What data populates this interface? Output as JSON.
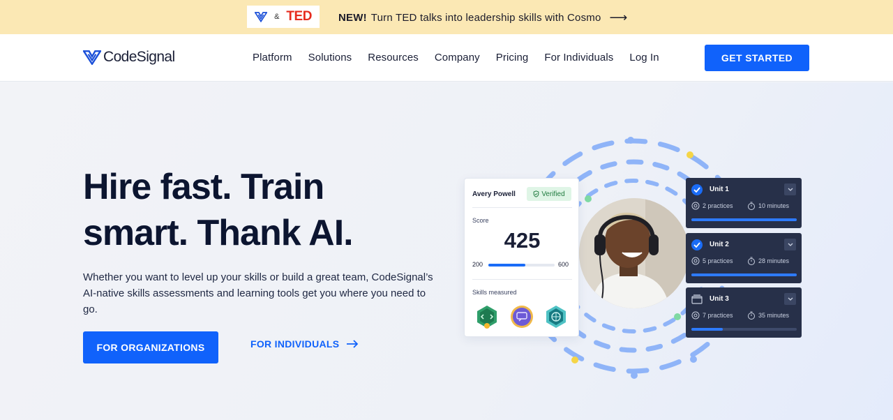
{
  "promo": {
    "and_symbol": "&",
    "partner_logo": "TED",
    "new_label": "NEW!",
    "text": "Turn TED talks into leadership skills with Cosmo"
  },
  "header": {
    "brand": "CodeSignal",
    "nav": [
      "Platform",
      "Solutions",
      "Resources",
      "Company",
      "Pricing",
      "For Individuals",
      "Log In"
    ],
    "cta": "GET STARTED"
  },
  "hero": {
    "title_line1": "Hire fast. Train",
    "title_line2": "smart. Thank AI.",
    "subtitle": "Whether you want to level up your skills or build a great team, CodeSignal’s AI-native skills assessments and learning tools get you where you need to go.",
    "primary_button": "FOR ORGANIZATIONS",
    "secondary_link": "FOR INDIVIDUALS"
  },
  "score_card": {
    "name": "Avery Powell",
    "verified": "Verified",
    "score_label": "Score",
    "score": "425",
    "range_min": "200",
    "range_max": "600",
    "score_fraction": 0.5625,
    "skills_label": "Skills measured",
    "badges": [
      "code-badge-icon",
      "communication-badge-icon",
      "brain-badge-icon"
    ]
  },
  "units": [
    {
      "title": "Unit 1",
      "practices": "2 practices",
      "minutes": "10 minutes",
      "completed": true,
      "progress": 1.0
    },
    {
      "title": "Unit 2",
      "practices": "5 practices",
      "minutes": "28 minutes",
      "completed": true,
      "progress": 1.0
    },
    {
      "title": "Unit 3",
      "practices": "7 practices",
      "minutes": "35 minutes",
      "completed": false,
      "progress": 0.3
    }
  ],
  "colors": {
    "accent": "#1062fb",
    "promo_bg": "#fbe8b4",
    "ted_red": "#e62b1e",
    "unit_card_bg": "#273049",
    "ring_blue": "#8fb4f8",
    "dot_yellow": "#f5d547",
    "dot_green": "#7fd9a3"
  }
}
